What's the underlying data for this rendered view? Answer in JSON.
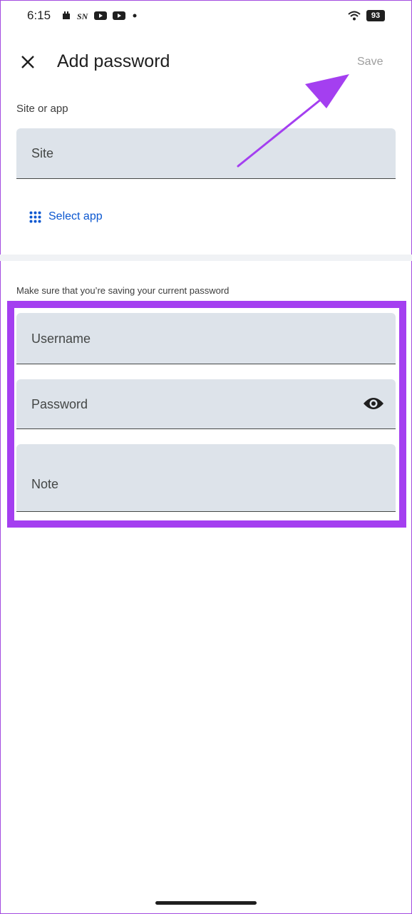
{
  "status_bar": {
    "time": "6:15",
    "left_icons": [
      "notification-app-icon",
      "notification-app-icon",
      "youtube-icon",
      "youtube-icon",
      "dot-icon"
    ],
    "battery": "93",
    "right_icons": [
      "wifi-icon",
      "battery-icon"
    ]
  },
  "app_bar": {
    "close_icon": "close-icon",
    "title": "Add password",
    "save_label": "Save"
  },
  "site_section": {
    "label": "Site or app",
    "site_placeholder": "Site",
    "select_app_label": "Select app",
    "select_app_icon": "grid-dots-icon"
  },
  "credentials_section": {
    "help_text": "Make sure that you’re saving your current password",
    "username_placeholder": "Username",
    "password_placeholder": "Password",
    "note_placeholder": "Note",
    "visibility_icon": "eye-icon"
  },
  "colors": {
    "field_background": "#dde3ea",
    "link_blue": "#0b57d0",
    "annotation_purple": "#a43ff0",
    "save_disabled": "#9e9e9e"
  }
}
